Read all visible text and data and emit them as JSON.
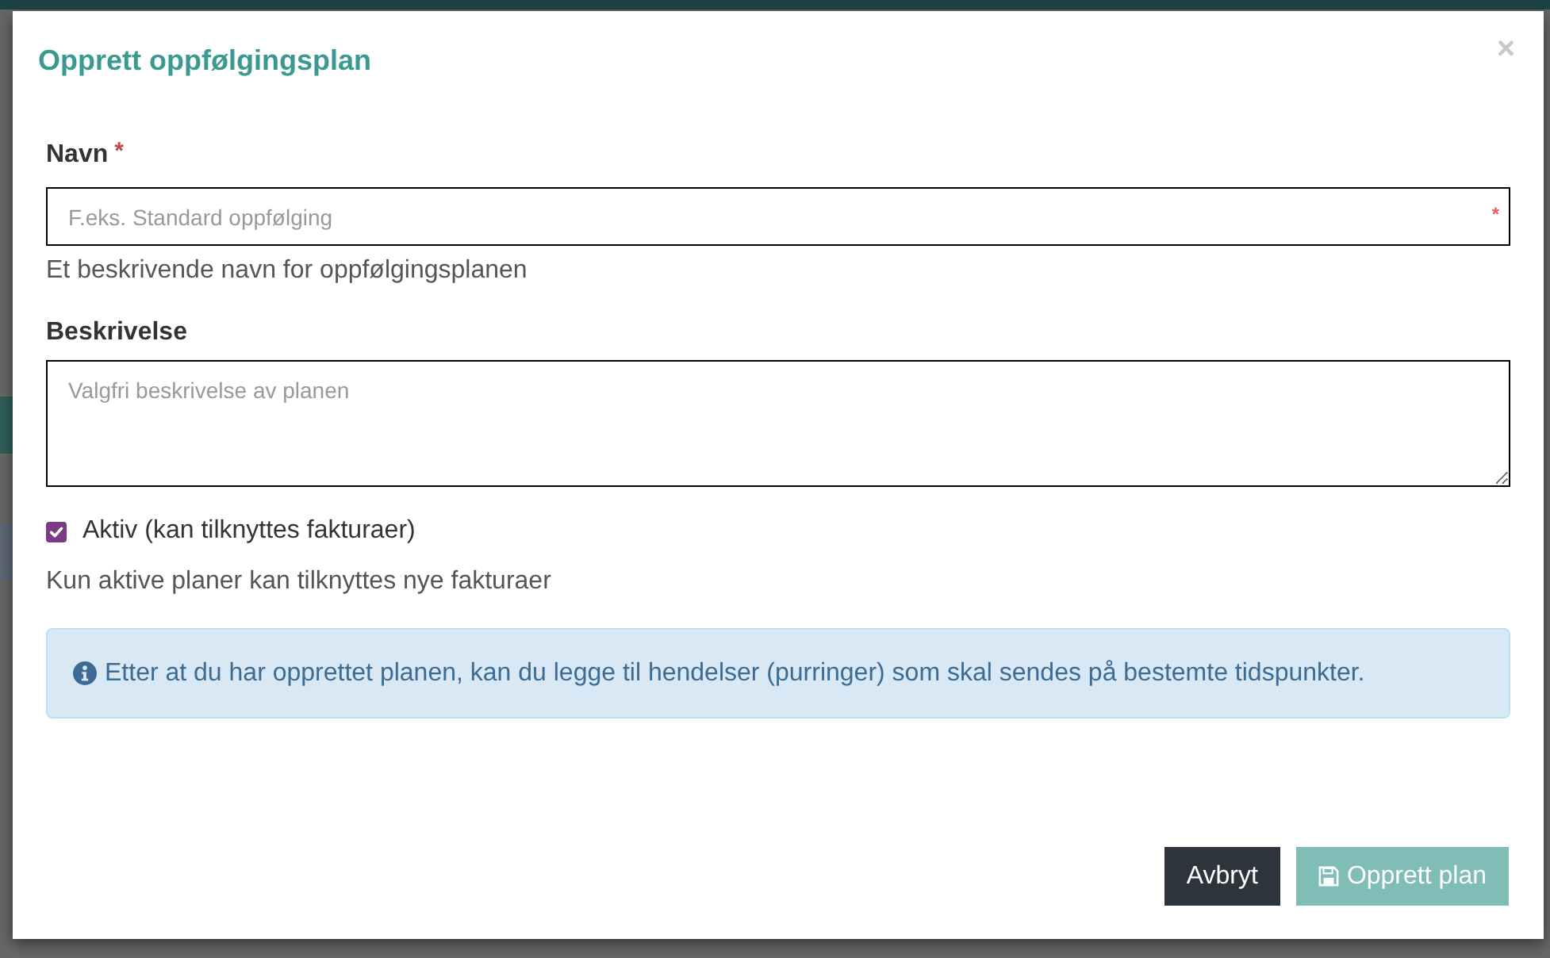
{
  "dialog": {
    "title": "Opprett oppfølgingsplan",
    "close": "×"
  },
  "fields": [
    {
      "kind": "text",
      "label": "Navn",
      "label_mark": "*",
      "placeholder": "F.eks. Standard oppfølging",
      "input_mark": "*",
      "help": "Et beskrivende navn for oppfølgingsplanen"
    },
    {
      "kind": "textarea",
      "label": "Beskrivelse",
      "placeholder": "Valgfri beskrivelse av planen"
    },
    {
      "kind": "checkbox",
      "label": "Aktiv (kan tilknyttes fakturaer)",
      "checked": true,
      "help": "Kun aktive planer kan tilknyttes nye fakturaer"
    }
  ],
  "alert": {
    "kind": "info",
    "text": "Etter at du har opprettet planen, kan du legge til hendelser (purringer) som skal sendes på bestemte tidspunkter."
  },
  "buttons": [
    {
      "kind": "cancel",
      "label": "Avbryt",
      "disabled": false
    },
    {
      "kind": "save",
      "label": "Opprett plan",
      "disabled": true
    }
  ]
}
